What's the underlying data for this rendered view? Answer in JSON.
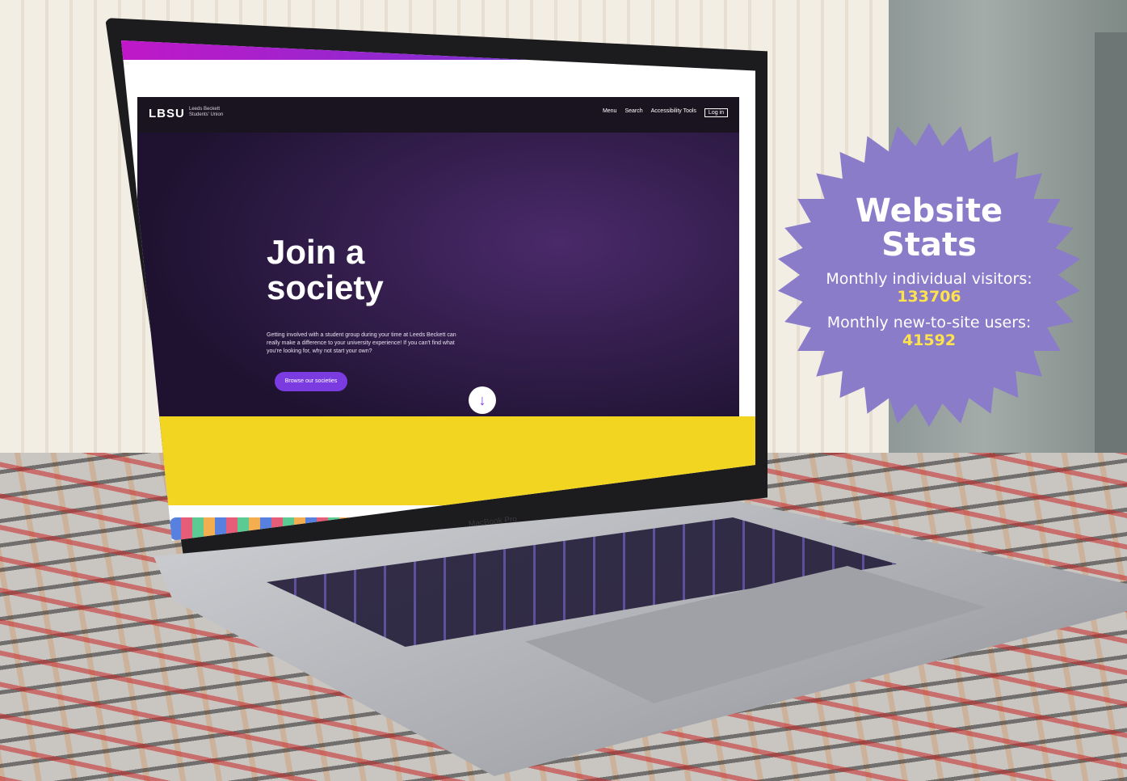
{
  "photo": {
    "brand": "MacBook Pro"
  },
  "website": {
    "logo": "LBSU",
    "logo_sub": "Leeds Beckett Students' Union",
    "nav": [
      "Menu",
      "Search",
      "Accessibility Tools",
      "Log in"
    ],
    "hero_title": "Join a society",
    "hero_text": "Getting involved with a student group during your time at Leeds Beckett can really make a difference to your university experience! If you can't find what you're looking for, why not start your own?",
    "hero_button": "Browse our societies"
  },
  "badge": {
    "title": "Website Stats",
    "stat1_label": "Monthly individual visitors:",
    "stat1_value": "133706",
    "stat2_label": "Monthly new-to-site users:",
    "stat2_value": "41592",
    "color": "#8a7cc8",
    "accent": "#ffe34d"
  }
}
